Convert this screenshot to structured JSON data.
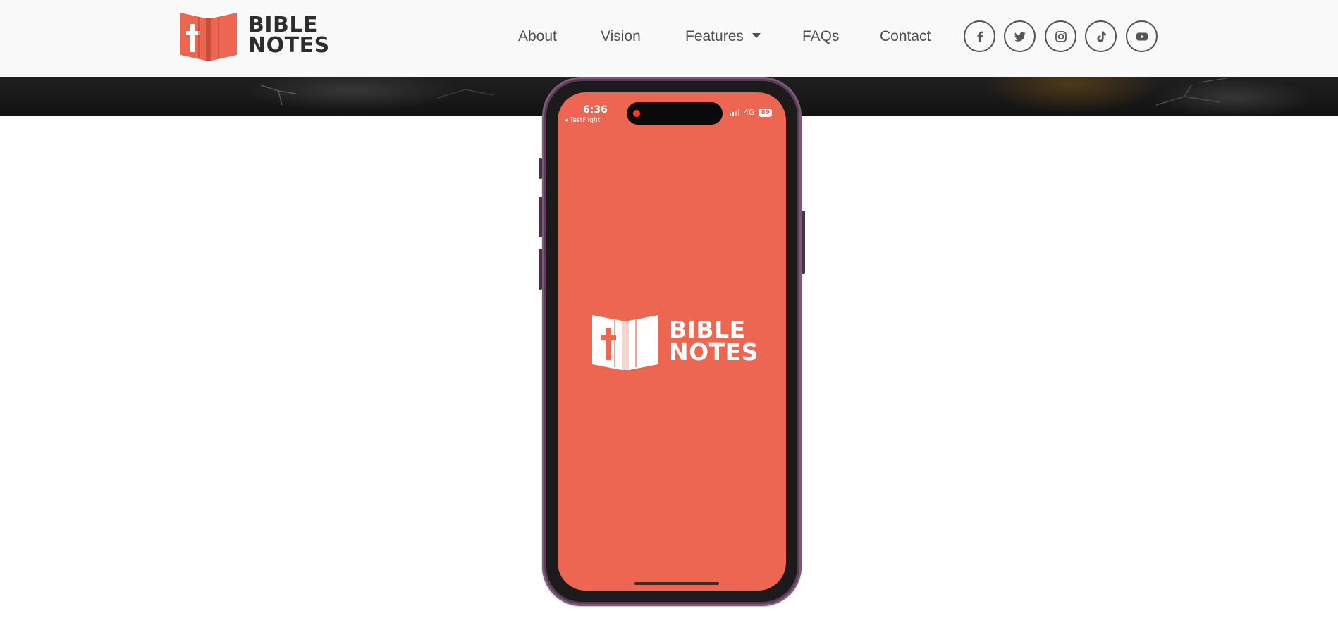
{
  "brand": {
    "name_line1": "BIBLE",
    "name_line2": "NOTES",
    "accent_color": "#ec6651"
  },
  "nav": {
    "items": [
      {
        "label": "About"
      },
      {
        "label": "Vision"
      },
      {
        "label": "Features",
        "has_dropdown": true
      },
      {
        "label": "FAQs"
      },
      {
        "label": "Contact"
      }
    ]
  },
  "social": [
    {
      "icon": "facebook-icon"
    },
    {
      "icon": "twitter-icon"
    },
    {
      "icon": "instagram-icon"
    },
    {
      "icon": "tiktok-icon"
    },
    {
      "icon": "youtube-icon"
    }
  ],
  "phone": {
    "status_time": "6:36",
    "back_label": "◂ TestFlight",
    "network": "4G",
    "battery": "89",
    "screen_color": "#ec6651",
    "splash_line1": "BIBLE",
    "splash_line2": "NOTES"
  }
}
